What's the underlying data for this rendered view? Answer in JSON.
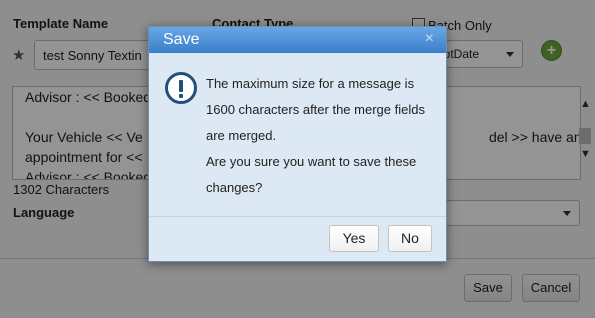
{
  "form": {
    "template_name_label": "Template Name",
    "contact_type_label": "Contact Type",
    "batch_only_label": "Batch Only",
    "template_name_value": "test Sonny Textin",
    "merge_field_select": "pptDate",
    "message_lines": [
      "Advisor : << Booked",
      "",
      "Your Vehicle << Ve                                                                                         del >> have an",
      "appointment for << ",
      "Advisor : << Booked"
    ],
    "char_count": "1302 Characters",
    "language_label": "Language",
    "save_button": "Save",
    "cancel_button": "Cancel"
  },
  "dialog": {
    "title": "Save",
    "close_glyph": "×",
    "message": [
      "The maximum size for a message is",
      "1600 characters after the merge fields",
      "are merged.",
      "Are you sure you want to save these",
      "changes?"
    ],
    "yes_label": "Yes",
    "no_label": "No"
  },
  "icons": {
    "info": "info-icon",
    "star": "star-icon",
    "add": "add-icon",
    "close": "close-icon"
  }
}
